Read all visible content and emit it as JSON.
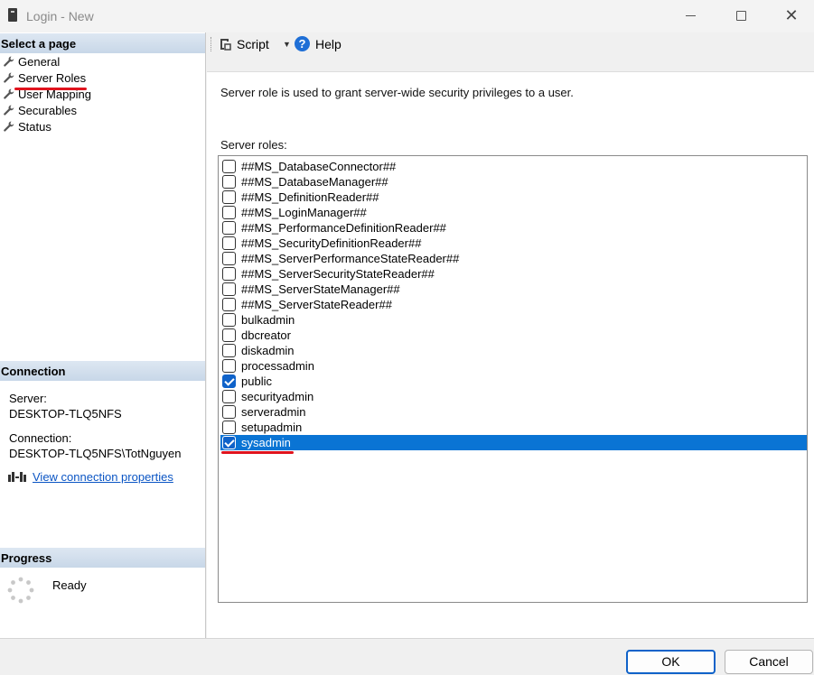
{
  "window": {
    "title": "Login - New",
    "minimize": "–",
    "maximize": "□",
    "close": "✕"
  },
  "left_panel": {
    "select_page_header": "Select a page",
    "pages": [
      {
        "label": "General",
        "icon": "wrench-icon",
        "selected": false
      },
      {
        "label": "Server Roles",
        "icon": "wrench-icon",
        "selected": true
      },
      {
        "label": "User Mapping",
        "icon": "wrench-icon",
        "selected": false
      },
      {
        "label": "Securables",
        "icon": "wrench-icon",
        "selected": false
      },
      {
        "label": "Status",
        "icon": "wrench-icon",
        "selected": false
      }
    ],
    "connection_header": "Connection",
    "server_label": "Server:",
    "server_value": "DESKTOP-TLQ5NFS",
    "connection_label": "Connection:",
    "connection_value": "DESKTOP-TLQ5NFS\\TotNguyen",
    "view_connection_link": "View connection properties",
    "progress_header": "Progress",
    "progress_status": "Ready"
  },
  "toolbar": {
    "script_label": "Script",
    "help_label": "Help",
    "help_icon_glyph": "?"
  },
  "main": {
    "description": "Server role is used to grant server-wide security privileges to a user.",
    "roles_label": "Server roles:",
    "roles": [
      {
        "label": "##MS_DatabaseConnector##",
        "checked": false
      },
      {
        "label": "##MS_DatabaseManager##",
        "checked": false
      },
      {
        "label": "##MS_DefinitionReader##",
        "checked": false
      },
      {
        "label": "##MS_LoginManager##",
        "checked": false
      },
      {
        "label": "##MS_PerformanceDefinitionReader##",
        "checked": false
      },
      {
        "label": "##MS_SecurityDefinitionReader##",
        "checked": false
      },
      {
        "label": "##MS_ServerPerformanceStateReader##",
        "checked": false
      },
      {
        "label": "##MS_ServerSecurityStateReader##",
        "checked": false
      },
      {
        "label": "##MS_ServerStateManager##",
        "checked": false
      },
      {
        "label": "##MS_ServerStateReader##",
        "checked": false
      },
      {
        "label": "bulkadmin",
        "checked": false
      },
      {
        "label": "dbcreator",
        "checked": false
      },
      {
        "label": "diskadmin",
        "checked": false
      },
      {
        "label": "processadmin",
        "checked": false
      },
      {
        "label": "public",
        "checked": true
      },
      {
        "label": "securityadmin",
        "checked": false
      },
      {
        "label": "serveradmin",
        "checked": false
      },
      {
        "label": "setupadmin",
        "checked": false
      },
      {
        "label": "sysadmin",
        "checked": true,
        "selected": true
      }
    ]
  },
  "buttons": {
    "ok": "OK",
    "cancel": "Cancel"
  },
  "colors": {
    "selection": "#0a74d4",
    "checkbox_checked": "#0f62c9",
    "annotation_underline": "#e0141e",
    "link": "#0b55c4"
  }
}
